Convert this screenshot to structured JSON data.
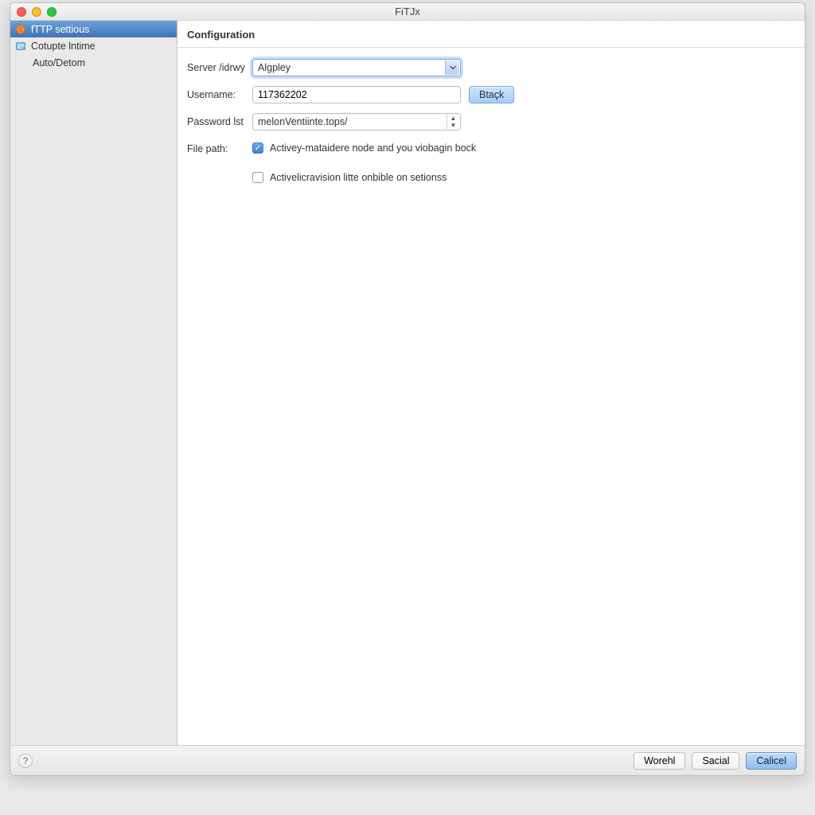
{
  "window": {
    "title": "FiTJx"
  },
  "sidebar": {
    "items": [
      {
        "label": "fTTP settious",
        "icon": "globe-icon",
        "selected": true
      },
      {
        "label": "Cotupte lntime",
        "icon": "folder-icon",
        "selected": false
      },
      {
        "label": "Auto/Detom",
        "icon": "",
        "selected": false,
        "indent": true
      }
    ]
  },
  "content": {
    "header": "Configuration",
    "server_label": "Server /idrwy",
    "server_value": "Algpley",
    "username_label": "Username:",
    "username_value": "117362202",
    "password_label": "Password lst",
    "password_value": "melonVentiinte.tops/",
    "filepath_label": "File path:",
    "check1_label": "Activey-mataidere node and you viobagin bock",
    "check1_checked": true,
    "check2_label": "Activelicravision litte onbible on setionss",
    "check2_checked": false,
    "btack_label": "Btaçk"
  },
  "footer": {
    "btn1": "Worehl",
    "btn2": "Sacial",
    "btn3": "Calicel"
  }
}
